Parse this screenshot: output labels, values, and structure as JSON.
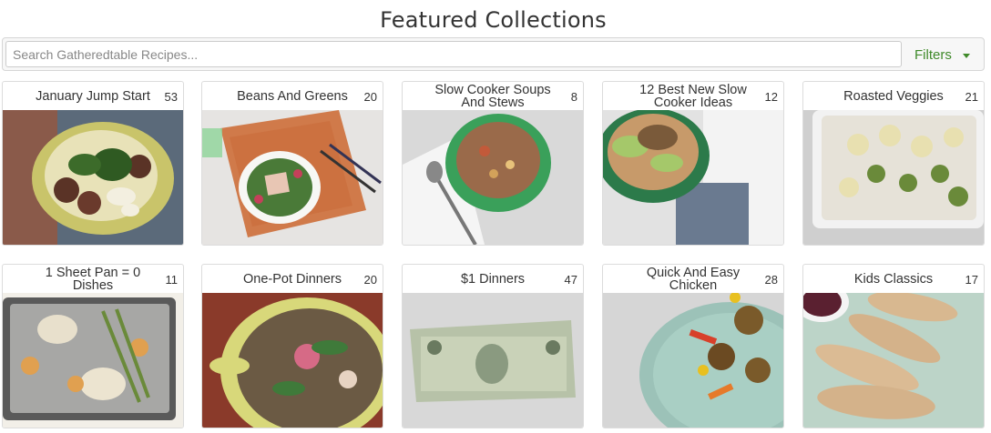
{
  "page_title": "Featured Collections",
  "search": {
    "placeholder": "Search Gatheredtable Recipes..."
  },
  "filters": {
    "label": "Filters"
  },
  "collections": [
    {
      "name": "January Jump Start",
      "count": "53"
    },
    {
      "name": "Beans And Greens",
      "count": "20"
    },
    {
      "name": "Slow Cooker Soups And Stews",
      "count": "8"
    },
    {
      "name": "12 Best New Slow Cooker Ideas",
      "count": "12"
    },
    {
      "name": "Roasted Veggies",
      "count": "21"
    },
    {
      "name": "1 Sheet Pan = 0 Dishes",
      "count": "11"
    },
    {
      "name": "One-Pot Dinners",
      "count": "20"
    },
    {
      "name": "$1 Dinners",
      "count": "47"
    },
    {
      "name": "Quick And Easy Chicken",
      "count": "28"
    },
    {
      "name": "Kids Classics",
      "count": "17"
    }
  ],
  "colors": {
    "accent": "#3f8a2a",
    "border": "#dcdcdc",
    "text": "#333333"
  }
}
